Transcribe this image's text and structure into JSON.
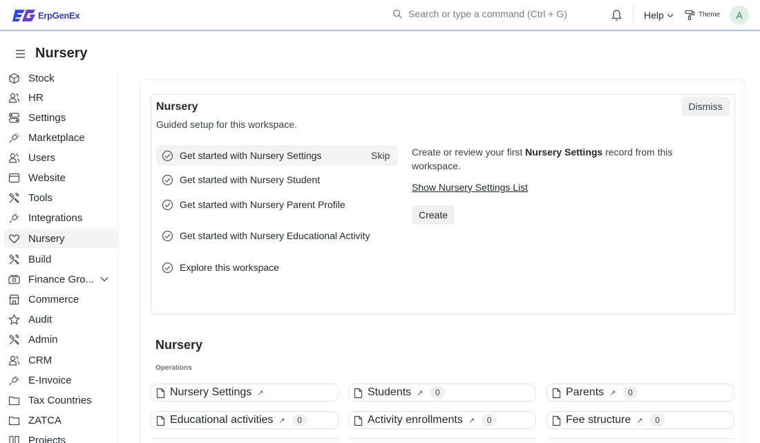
{
  "app": {
    "logo_text": "ErpGenEx"
  },
  "navbar": {
    "search_placeholder": "Search or type a command (Ctrl + G)",
    "help_label": "Help",
    "theme_label": "Theme",
    "avatar_initial": "A"
  },
  "page": {
    "title": "Nursery"
  },
  "sidebar": {
    "items": [
      {
        "label": "Stock",
        "icon": "stock-icon"
      },
      {
        "label": "HR",
        "icon": "users-icon"
      },
      {
        "label": "Settings",
        "icon": "toggle-icon"
      },
      {
        "label": "Marketplace",
        "icon": "plug-icon"
      },
      {
        "label": "Users",
        "icon": "users-icon"
      },
      {
        "label": "Website",
        "icon": "browser-icon"
      },
      {
        "label": "Tools",
        "icon": "tools-icon"
      },
      {
        "label": "Integrations",
        "icon": "plug-icon"
      },
      {
        "label": "Nursery",
        "icon": "heart-icon",
        "active": true
      },
      {
        "label": "Build",
        "icon": "tools-icon"
      },
      {
        "label": "Finance Gro...",
        "icon": "money-icon",
        "expandable": true
      },
      {
        "label": "Commerce",
        "icon": "store-icon"
      },
      {
        "label": "Audit",
        "icon": "star-icon"
      },
      {
        "label": "Admin",
        "icon": "tools-icon"
      },
      {
        "label": "CRM",
        "icon": "users-icon"
      },
      {
        "label": "E-Invoice",
        "icon": "plug-icon"
      },
      {
        "label": "Tax Countries",
        "icon": "folder-icon"
      },
      {
        "label": "ZATCA",
        "icon": "folder-icon"
      },
      {
        "label": "Projects",
        "icon": "columns-icon"
      }
    ]
  },
  "onboarding": {
    "title": "Nursery",
    "subtitle": "Guided setup for this workspace.",
    "dismiss_label": "Dismiss",
    "skip_label": "Skip",
    "steps": [
      {
        "label": "Get started with Nursery Settings"
      },
      {
        "label": "Get started with Nursery Student"
      },
      {
        "label": "Get started with Nursery Parent Profile"
      },
      {
        "label": "Get started with Nursery Educational Activity"
      },
      {
        "label": "Explore this workspace"
      }
    ],
    "description_prefix": "Create or review your first ",
    "description_bold": "Nursery Settings",
    "description_suffix": " record from this workspace.",
    "show_list_label": "Show Nursery Settings List",
    "create_label": "Create"
  },
  "workspace": {
    "title": "Nursery",
    "section_label": "Operations",
    "links": [
      {
        "label": "Nursery Settings",
        "count": null
      },
      {
        "label": "Students",
        "count": "0"
      },
      {
        "label": "Parents",
        "count": "0"
      },
      {
        "label": "Educational activities",
        "count": "0"
      },
      {
        "label": "Activity enrollments",
        "count": "0"
      },
      {
        "label": "Fee structure",
        "count": "0"
      }
    ]
  },
  "colors": {
    "accent": "#3b3fb8",
    "avatar_bg": "#dcf3e3",
    "avatar_fg": "#307f47",
    "navbar_border": "#a9c1e6"
  }
}
